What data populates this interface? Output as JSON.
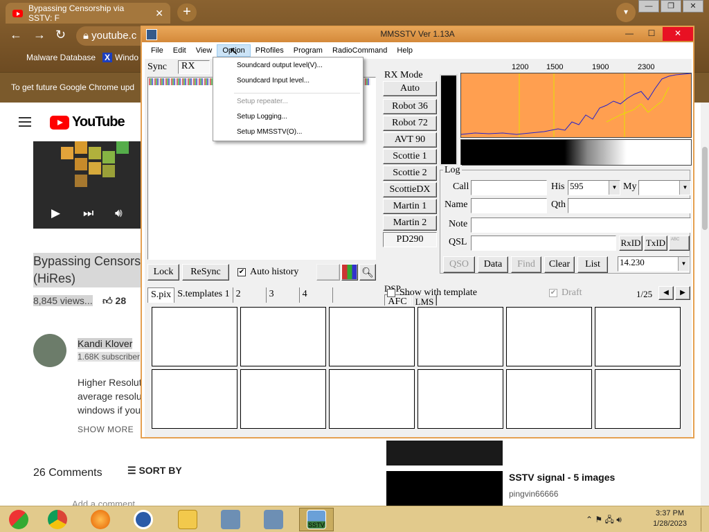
{
  "chrome": {
    "tab_title": "Bypassing Censorship via SSTV: F",
    "omnibox_text": "youtube.c",
    "bookmarks": [
      "Malware Database",
      "Windo"
    ],
    "info_bar": "To get future Google Chrome upd"
  },
  "youtube": {
    "logo_text": "YouTube",
    "video_title": "Bypassing Censorsl (HiRes)",
    "views": "8,845 views...",
    "likes": "28",
    "channel_name": "Kandi Klover",
    "subscribers": "1.68K subscriber",
    "description": "Higher Resolut average resolu windows if you",
    "show_more": "SHOW MORE",
    "comments_count": "26 Comments",
    "sort_by": "SORT BY",
    "add_comment": "Add a comment...",
    "related_title": "SSTV signal - 5 images",
    "related_channel": "pingvin66666"
  },
  "mmsstv": {
    "title": "MMSSTV Ver 1.13A",
    "menu": [
      "File",
      "Edit",
      "View",
      "Option",
      "PRofiles",
      "Program",
      "RadioCommand",
      "Help"
    ],
    "sync_label": "Sync",
    "rx_tab": "RX",
    "rx_mode_label": "RX Mode",
    "rx_modes": [
      "Auto",
      "Robot 36",
      "Robot 72",
      "AVT 90",
      "Scottie 1",
      "Scottie 2",
      "ScottieDX",
      "Martin 1",
      "Martin 2",
      "PD290"
    ],
    "freq_ticks": [
      "1200",
      "1500",
      "1900",
      "2300"
    ],
    "log_label": "Log",
    "call_label": "Call",
    "his_label": "His",
    "his_value": "595",
    "my_label": "My",
    "name_label": "Name",
    "qth_label": "Qth",
    "note_label": "Note",
    "qsl_label": "QSL",
    "rxid_button": "RxID",
    "txid_button": "TxID",
    "abc_button": "ABC",
    "lock_button": "Lock",
    "resync_button": "ReSync",
    "auto_history_label": "Auto history",
    "dsp_label": "DSP",
    "afc_button": "AFC",
    "lms_button": "LMS",
    "qso_button": "QSO",
    "data_button": "Data",
    "find_button": "Find",
    "clear_button": "Clear",
    "list_button": "List",
    "frequency_value": "14.230",
    "show_with_template_label": "Show with template",
    "draft_label": "Draft",
    "page_counter": "1/25",
    "bottom_tabs": [
      "S.pix",
      "S.templates 1",
      "2",
      "3",
      "4"
    ]
  },
  "options_menu": {
    "items": [
      "Soundcard output level(V)...",
      "Soundcard Input level...",
      "Setup repeater...",
      "Setup Logging...",
      "Setup MMSSTV(O)..."
    ]
  },
  "taskbar": {
    "time": "3:37 PM",
    "date": "1/28/2023",
    "sstv_label": "SSTV"
  }
}
